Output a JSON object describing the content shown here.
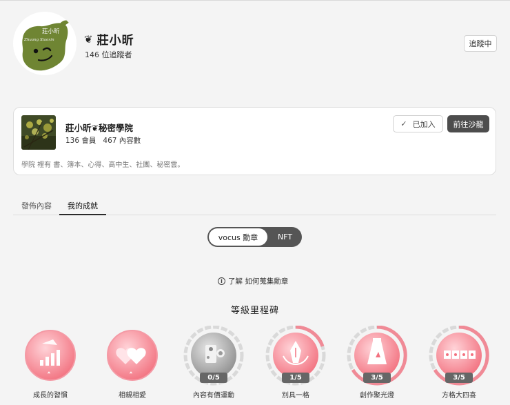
{
  "profile": {
    "avatar_text_top": "莊小昕",
    "avatar_text_script": "Zhuang Xiaoxin",
    "name_mark": "❦",
    "name": "莊小昕",
    "followers": "146 位追蹤者",
    "follow_label": "追蹤中"
  },
  "salon": {
    "title": "莊小昕❦秘密學院",
    "members": "136 會員",
    "contents": "467 內容數",
    "description": "學院 裡有 書、簿本、心得、高中生、社團、秘密雲。",
    "joined_label": "已加入",
    "goto_label": "前往沙龍"
  },
  "tabs": [
    {
      "label": "發佈內容",
      "active": false
    },
    {
      "label": "我的成就",
      "active": true
    }
  ],
  "toggle": {
    "left": "vocus 勳章",
    "right": "NFT",
    "selected": "vocus 勳章"
  },
  "learn": {
    "icon": "i",
    "text": "了解 如何蒐集勳章"
  },
  "section_title": "等級里程碑",
  "badges": [
    {
      "label": "成長的習慣",
      "count": "",
      "progress": 1.0,
      "style": "pink"
    },
    {
      "label": "相親相愛",
      "count": "",
      "progress": 1.0,
      "style": "pink"
    },
    {
      "label": "內容有價運動",
      "count": "0/5",
      "progress": 0.0,
      "style": "gray"
    },
    {
      "label": "別具一格",
      "count": "1/5",
      "progress": 0.2,
      "style": "pink"
    },
    {
      "label": "創作聚光燈",
      "count": "3/5",
      "progress": 0.6,
      "style": "pink"
    },
    {
      "label": "方格大四喜",
      "count": "3/5",
      "progress": 0.6,
      "style": "pink"
    }
  ],
  "colors": {
    "accent_dark": "#4d4d4d",
    "badge_pink": "#f26e7e",
    "badge_gray": "#9a9a9a"
  }
}
